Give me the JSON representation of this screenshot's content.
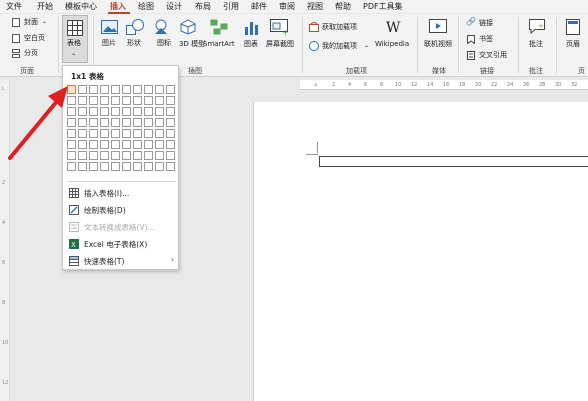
{
  "menubar": {
    "items": [
      "文件",
      "开始",
      "模板中心",
      "插入",
      "绘图",
      "设计",
      "布局",
      "引用",
      "邮件",
      "审阅",
      "视图",
      "帮助",
      "PDF工具集"
    ],
    "active": "插入"
  },
  "ribbon": {
    "pages": {
      "cover": "封面",
      "blank": "空白页",
      "break": "分页",
      "group": "页面"
    },
    "table": {
      "label": "表格",
      "group": "表格"
    },
    "illustrations": {
      "picture": "图片",
      "shapes": "形状",
      "icons": "图标",
      "model3d": "3D 模型",
      "smartart": "SmartArt",
      "chart": "图表",
      "screenshot": "屏幕截图",
      "group": "插图"
    },
    "addins": {
      "get": "获取加载项",
      "my": "我的加载项",
      "wikipedia": "Wikipedia",
      "group": "加载项"
    },
    "media": {
      "video": "联机视频",
      "group": "媒体"
    },
    "links": {
      "link": "链接",
      "bookmark": "书签",
      "crossref": "交叉引用",
      "group": "链接"
    },
    "comments": {
      "comment": "批注",
      "group": "批注"
    },
    "header": {
      "label": "页眉",
      "group": "页"
    }
  },
  "ruler": {
    "ticks": [
      "2",
      "4",
      "6",
      "8",
      "10",
      "12",
      "14",
      "16",
      "18",
      "20",
      "22",
      "24",
      "26",
      "28",
      "30",
      "32"
    ]
  },
  "dropdown": {
    "title": "1x1 表格",
    "grid_cols": 10,
    "grid_rows": 8,
    "items": [
      {
        "label": "插入表格(I)...",
        "icon": "insert-table-icon",
        "disabled": false
      },
      {
        "label": "绘制表格(D)",
        "icon": "draw-table-icon",
        "disabled": false
      },
      {
        "label": "文本转换成表格(V)...",
        "icon": "convert-text-icon",
        "disabled": true
      },
      {
        "label": "Excel 电子表格(X)",
        "icon": "excel-icon",
        "disabled": false
      },
      {
        "label": "快速表格(T)",
        "icon": "quick-table-icon",
        "disabled": false
      }
    ]
  },
  "colors": {
    "accent": "#b7472a",
    "highlight": "#e07b39",
    "arrow": "#e02020"
  }
}
